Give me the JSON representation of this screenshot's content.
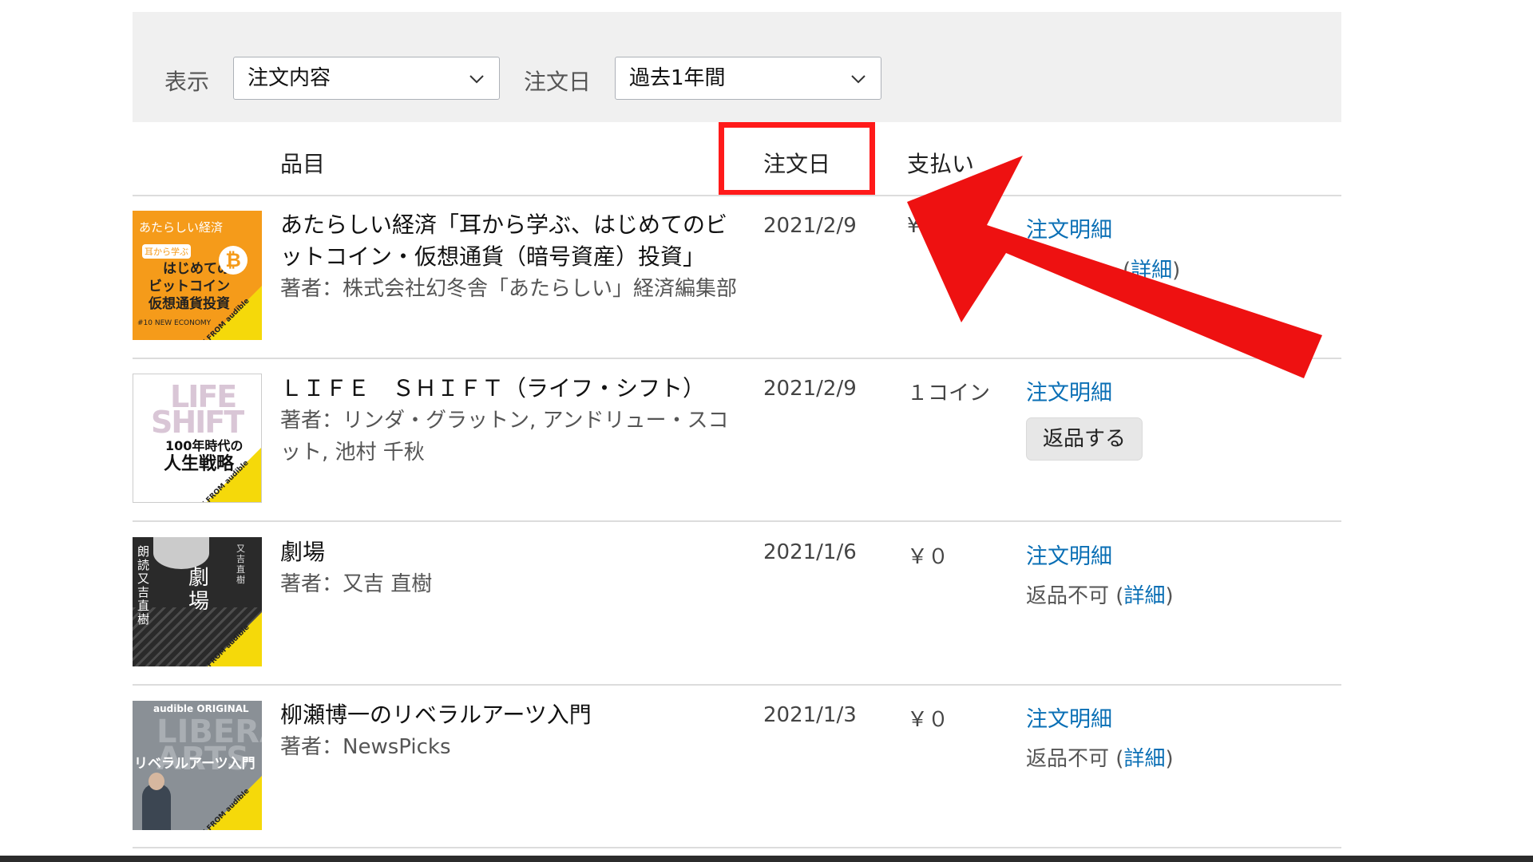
{
  "filters": {
    "display_label": "表示",
    "display_value": "注文内容",
    "date_label": "注文日",
    "date_value": "過去1年間"
  },
  "columns": {
    "item": "品目",
    "date": "注文日",
    "payment": "支払い"
  },
  "orders": [
    {
      "title": "あたらしい経済「耳から学ぶ、はじめてのビットコイン・仮想通貨（暗号資産）投資」",
      "author": "著者：株式会社幻冬舎「あたらしい」経済編集部",
      "date": "2021/2/9",
      "payment": "¥",
      "detail_link": "注文明細",
      "detail_open": "(",
      "detail_link2": "詳細",
      "detail_close": ")",
      "cover": {
        "top": "あたらしい経済",
        "small": "耳から学ぶ",
        "l1": "はじめての",
        "coin": "₿",
        "l2": "ビットコイン",
        "l3": "仮想通貨投資",
        "l4": "#10 NEW ECONOMY"
      }
    },
    {
      "title": "ＬＩＦＥ　ＳＨＩＦＴ（ライフ・シフト）",
      "author": "著者：リンダ・グラットン, アンドリュー・スコット, 池村 千秋",
      "date": "2021/2/9",
      "payment": "１コイン",
      "detail_link": "注文明細",
      "button": "返品する",
      "cover": {
        "big1": "LIFE",
        "big2": "SHIFT",
        "s1": "100年時代の",
        "s2": "人生戦略"
      }
    },
    {
      "title": "劇場",
      "author": "著者：又吉 直樹",
      "date": "2021/1/6",
      "payment": "￥０",
      "detail_link": "注文明細",
      "note": "返品不可",
      "note_open": "(",
      "note_link": "詳細",
      "note_close": ")",
      "cover": {
        "v1": "朗読又吉直樹",
        "v2": "劇場",
        "v3": "又吉直樹"
      }
    },
    {
      "title": "柳瀬博一のリベラルアーツ入門",
      "author": "著者：NewsPicks",
      "date": "2021/1/3",
      "payment": "￥０",
      "detail_link": "注文明細",
      "note": "返品不可",
      "note_open": "(",
      "note_link": "詳細",
      "note_close": ")",
      "cover": {
        "au": "audible ORIGINAL",
        "ghost": "LIBERAL ARTS",
        "title": "リベラルアーツ入門"
      }
    }
  ],
  "cover_badge": "ONLY FROM audible",
  "colors": {
    "link": "#0a6fb5",
    "highlight": "#ff1a1a",
    "arrow": "#ee1111",
    "filter_bg": "#f0f0f0"
  }
}
